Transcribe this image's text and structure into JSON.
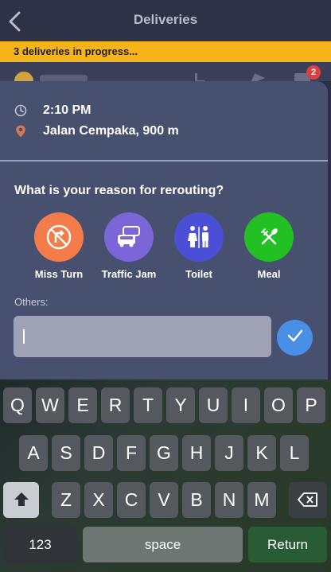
{
  "header": {
    "title": "Deliveries",
    "back_icon": "chevron-left-icon"
  },
  "banner": {
    "text": "3 deliveries in progress..."
  },
  "badge": {
    "count": "2"
  },
  "details": {
    "time": "2:10 PM",
    "location": "Jalan Cempaka, 900 m"
  },
  "question": "What is your reason for rerouting?",
  "reasons": [
    {
      "label": "Miss Turn",
      "color": "#f47c4a",
      "icon": "no-turn-icon"
    },
    {
      "label": "Traffic Jam",
      "color": "#7a66d6",
      "icon": "traffic-cars-icon"
    },
    {
      "label": "Toilet",
      "color": "#4a4fd6",
      "icon": "restroom-icon"
    },
    {
      "label": "Meal",
      "color": "#22c022",
      "icon": "utensils-icon"
    }
  ],
  "others": {
    "label": "Others:",
    "value": "",
    "submit_icon": "check-icon"
  },
  "keyboard": {
    "row1": [
      "Q",
      "W",
      "E",
      "R",
      "T",
      "Y",
      "U",
      "I",
      "O",
      "P"
    ],
    "row2": [
      "A",
      "S",
      "D",
      "F",
      "G",
      "H",
      "J",
      "K",
      "L"
    ],
    "row3": [
      "Z",
      "X",
      "C",
      "V",
      "B",
      "N",
      "M"
    ],
    "numbers_label": "123",
    "space_label": "space",
    "return_label": "Return",
    "shift_icon": "shift-arrow-icon",
    "backspace_icon": "backspace-icon"
  }
}
